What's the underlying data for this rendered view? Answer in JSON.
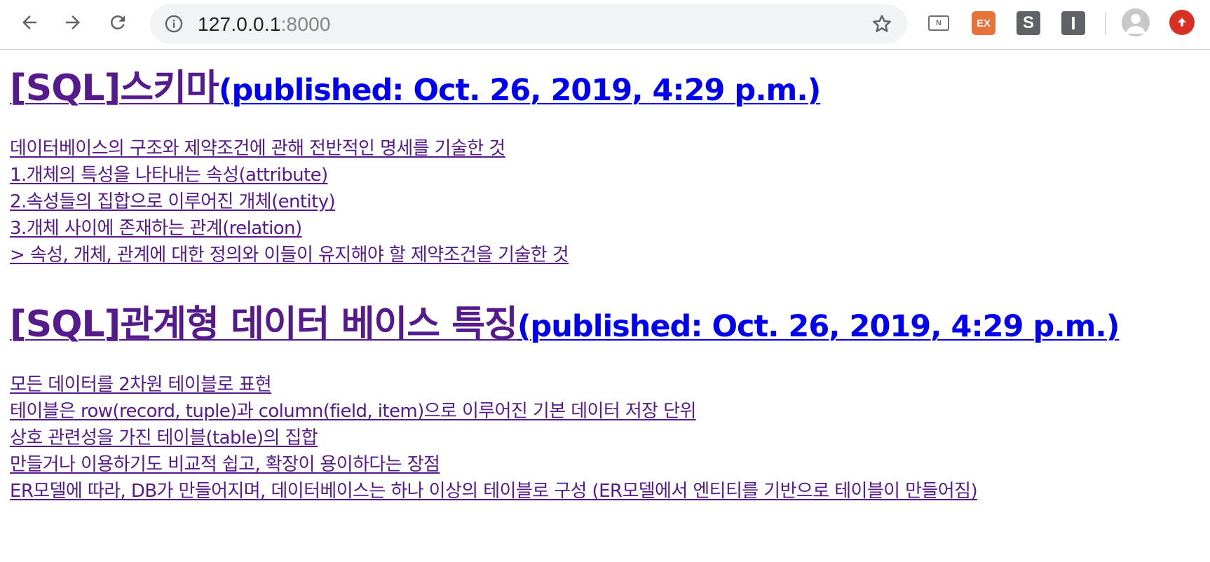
{
  "browser": {
    "url_host": "127.0.0.1",
    "url_port": ":8000",
    "back_icon": "arrow-left-icon",
    "forward_icon": "arrow-right-icon",
    "reload_icon": "reload-icon",
    "info_icon": "info-icon",
    "star_icon": "star-icon",
    "extensions": [
      {
        "name": "N",
        "icon": "naver-extension-icon"
      },
      {
        "name": "EX",
        "icon": "ex-extension-icon"
      },
      {
        "name": "S",
        "icon": "s-extension-icon"
      },
      {
        "name": "I",
        "icon": "i-extension-icon"
      }
    ],
    "profile_icon": "avatar-icon",
    "update_icon": "update-arrow-icon",
    "colors": {
      "update": "#d93025",
      "ex_extension": "#e8733a",
      "omnibox_bg": "#f1f3f4"
    }
  },
  "posts": [
    {
      "title": "[SQL]스키마",
      "published": "(published: Oct. 26, 2019, 4:29 p.m.)",
      "lines": [
        "데이터베이스의 구조와 제약조건에 관해 전반적인 명세를 기술한 것",
        "1.개체의 특성을 나타내는 속성(attribute)",
        "2.속성들의 집합으로 이루어진 개체(entity)",
        "3.개체 사이에 존재하는 관계(relation)",
        "> 속성, 개체, 관계에 대한 정의와 이들이 유지해야 할 제약조건을 기술한 것"
      ]
    },
    {
      "title": "[SQL]관계형 데이터 베이스 특징",
      "published": "(published: Oct. 26, 2019, 4:29 p.m.)",
      "lines": [
        "모든 데이터를 2차원 테이블로 표현",
        "테이블은 row(record, tuple)과 column(field, item)으로 이루어진 기본 데이터 저장 단위",
        "상호 관련성을 가진 테이블(table)의 집합",
        "만들거나 이용하기도 비교적 쉽고, 확장이 용이하다는 장점",
        "ER모델에 따라, DB가 만들어지며, 데이터베이스는 하나 이상의 테이블로 구성 (ER모델에서 엔티티를 기반으로 테이블이 만들어짐)"
      ]
    }
  ],
  "colors": {
    "visited_link": "#551a8b",
    "link": "#0000ee"
  }
}
